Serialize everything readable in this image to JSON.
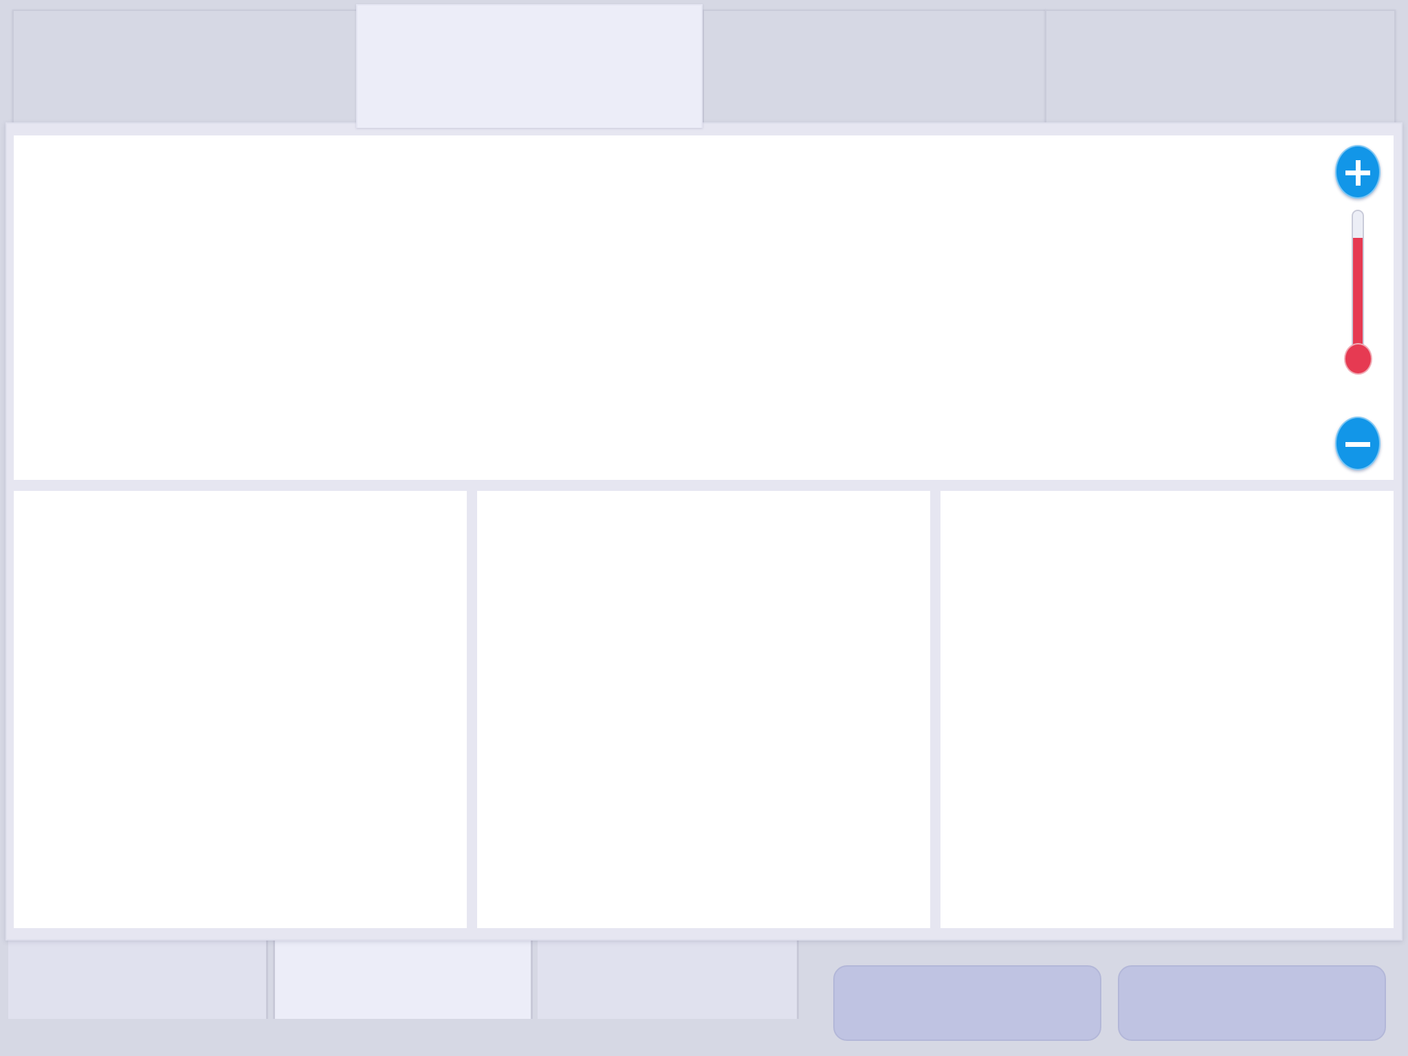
{
  "top_tabs": [
    {
      "label": "",
      "active": false
    },
    {
      "label": "",
      "active": true
    },
    {
      "label": "",
      "active": false
    },
    {
      "label": "",
      "active": false
    }
  ],
  "zoom": {
    "level_fraction": 0.82,
    "zoom_in_icon": "plus-icon",
    "zoom_out_icon": "minus-icon",
    "button_color": "#1296e8",
    "fill_color": "#e63a52"
  },
  "bottom_tabs": [
    {
      "label": "",
      "active": false
    },
    {
      "label": "",
      "active": true
    },
    {
      "label": "",
      "active": false
    }
  ],
  "actions": [
    {
      "label": ""
    },
    {
      "label": ""
    }
  ]
}
